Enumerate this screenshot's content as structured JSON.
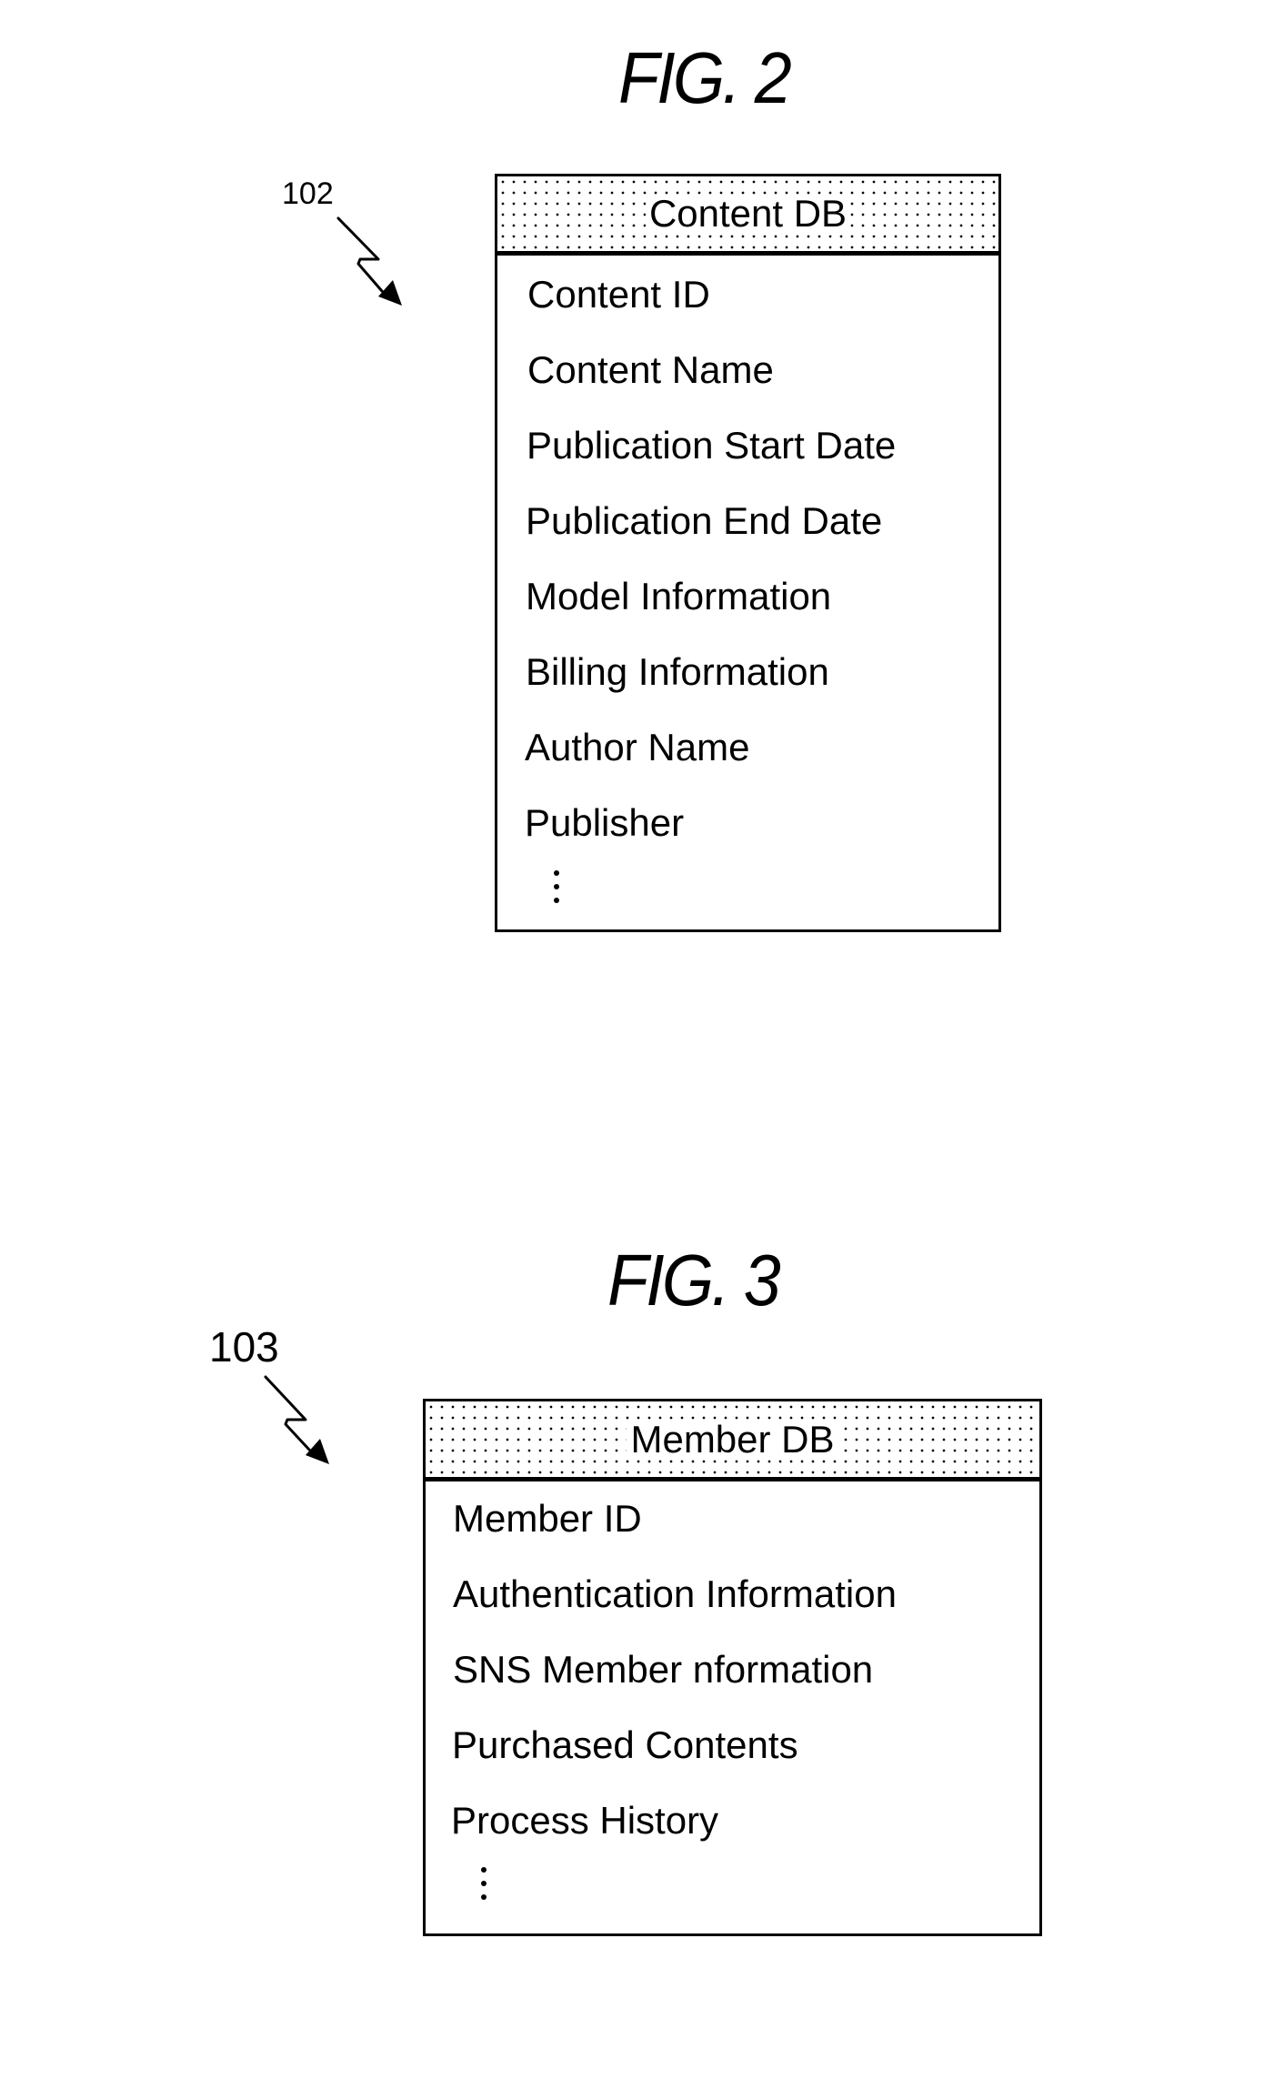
{
  "figures": [
    {
      "title": "FIG. 2",
      "reference_numeral": "102",
      "table": {
        "header": "Content DB",
        "fields": [
          "Content ID",
          "Content Name",
          "Publication Start Date",
          "Publication End Date",
          "Model Information",
          "Billing Information",
          "Author Name",
          "Publisher"
        ],
        "continuation": "⋮"
      }
    },
    {
      "title": "FIG. 3",
      "reference_numeral": "103",
      "table": {
        "header": "Member DB",
        "fields": [
          "Member ID",
          "Authentication Information",
          "SNS Member nformation",
          "Purchased Contents",
          "Process History"
        ],
        "continuation": "⋮"
      }
    }
  ]
}
